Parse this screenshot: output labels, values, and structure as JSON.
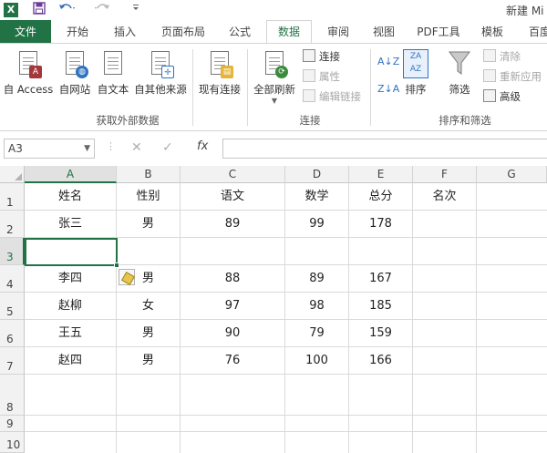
{
  "title_bar": {
    "app_icon": "X",
    "title": "新建 Mi"
  },
  "quick_access": {
    "save_icon": "save-icon",
    "undo_icon": "undo-icon",
    "redo_icon": "redo-icon",
    "customize_icon": "customize-icon"
  },
  "tabs": {
    "file": "文件",
    "items": [
      "开始",
      "插入",
      "页面布局",
      "公式",
      "数据",
      "审阅",
      "视图",
      "PDF工具",
      "模板",
      "百度"
    ],
    "active": "数据"
  },
  "ribbon": {
    "get_external": {
      "access": "自 Access",
      "web": "自网站",
      "text": "自文本",
      "other": "自其他来源",
      "label": "获取外部数据"
    },
    "existing_connections": "现有连接",
    "connections": {
      "refresh_all": "全部刷新",
      "connections": "连接",
      "properties": "属性",
      "edit_links": "编辑链接",
      "label": "连接"
    },
    "sort_filter": {
      "sort": "排序",
      "filter": "筛选",
      "clear": "清除",
      "reapply": "重新应用",
      "advanced": "高级",
      "label": "排序和筛选"
    }
  },
  "formula_bar": {
    "name_box": "A3",
    "fx": "fx",
    "formula": ""
  },
  "grid": {
    "columns": [
      "A",
      "B",
      "C",
      "D",
      "E",
      "F",
      "G"
    ],
    "selected_column": "A",
    "rows": [
      "1",
      "2",
      "3",
      "4",
      "5",
      "6",
      "7",
      "8",
      "9",
      "10"
    ],
    "selected_row": "3",
    "cells": [
      [
        "姓名",
        "性别",
        "语文",
        "数学",
        "总分",
        "名次"
      ],
      [
        "张三",
        "男",
        "89",
        "99",
        "178",
        ""
      ],
      [
        "",
        "",
        "",
        "",
        "",
        ""
      ],
      [
        "李四",
        "男",
        "88",
        "89",
        "167",
        ""
      ],
      [
        "赵柳",
        "女",
        "97",
        "98",
        "185",
        ""
      ],
      [
        "王五",
        "男",
        "90",
        "79",
        "159",
        ""
      ],
      [
        "赵四",
        "男",
        "76",
        "100",
        "166",
        ""
      ]
    ]
  },
  "colors": {
    "accent": "#217346",
    "header_bg": "#f2f2f2",
    "grid_line": "#dadada"
  }
}
